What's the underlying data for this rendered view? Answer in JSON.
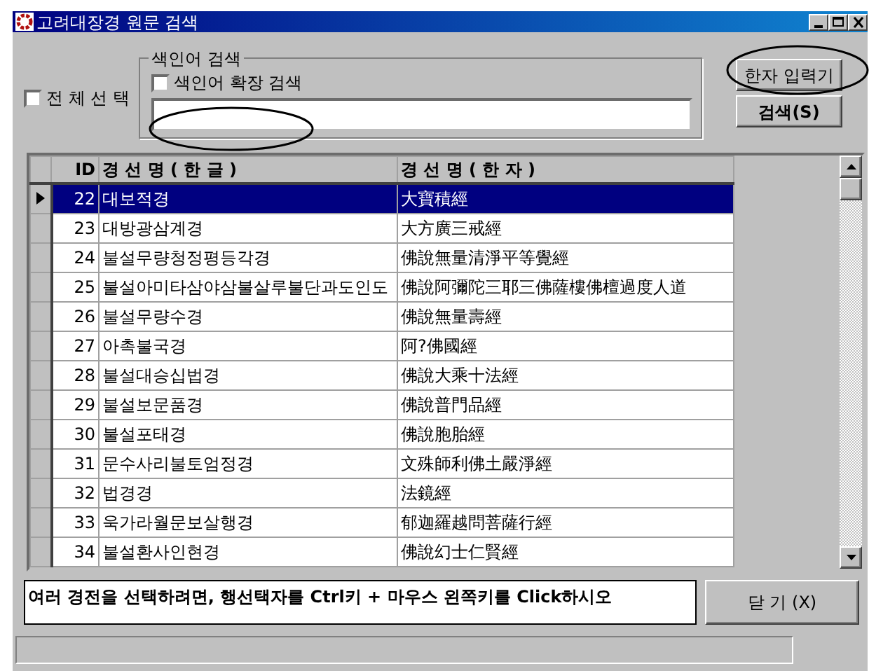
{
  "window": {
    "title": "고려대장경 원문 검색"
  },
  "select_all": {
    "label": "전 체 선 택",
    "checked": false
  },
  "index_search": {
    "legend": "색인어 검색",
    "extended": {
      "label": "색인어 확장 검색",
      "checked": false
    }
  },
  "buttons": [
    {
      "label": "한자 입력기",
      "bold": false
    },
    {
      "label": "검색(S)",
      "bold": true
    }
  ],
  "table": {
    "columns": [
      "ID",
      "경 선 명 ( 한 글 )",
      "경 선 명 ( 한 자 )"
    ],
    "rows": [
      {
        "id": "22",
        "name_ko": "대보적경",
        "name_hanja": "大寶積經",
        "selected": true
      },
      {
        "id": "23",
        "name_ko": "대방광삼계경",
        "name_hanja": "大方廣三戒經",
        "selected": false
      },
      {
        "id": "24",
        "name_ko": "불설무량청정평등각경",
        "name_hanja": "佛說無量清淨平等覺經",
        "selected": false
      },
      {
        "id": "25",
        "name_ko": "불설아미타삼야삼불살루불단과도인도",
        "name_hanja": "佛說阿彌陀三耶三佛薩樓佛檀過度人道",
        "selected": false
      },
      {
        "id": "26",
        "name_ko": "불설무량수경",
        "name_hanja": "佛說無量壽經",
        "selected": false
      },
      {
        "id": "27",
        "name_ko": "아촉불국경",
        "name_hanja": "阿?佛國經",
        "selected": false
      },
      {
        "id": "28",
        "name_ko": "불설대승십법경",
        "name_hanja": "佛說大乘十法經",
        "selected": false
      },
      {
        "id": "29",
        "name_ko": "불설보문품경",
        "name_hanja": "佛說普門品經",
        "selected": false
      },
      {
        "id": "30",
        "name_ko": "불설포태경",
        "name_hanja": "佛說胞胎經",
        "selected": false
      },
      {
        "id": "31",
        "name_ko": "문수사리불토엄정경",
        "name_hanja": "文殊師利佛土嚴淨經",
        "selected": false
      },
      {
        "id": "32",
        "name_ko": "법경경",
        "name_hanja": "法鏡經",
        "selected": false
      },
      {
        "id": "33",
        "name_ko": "욱가라월문보살행경",
        "name_hanja": "郁迦羅越問菩薩行經",
        "selected": false
      },
      {
        "id": "34",
        "name_ko": "불설환사인현경",
        "name_hanja": "佛說幻士仁賢經",
        "selected": false
      }
    ]
  },
  "hint": "여러 경전을 선택하려면, 행선택자를 Ctrl키 + 마우스 왼쪽키를 Click하시오",
  "close_button": {
    "label": "닫 기 (X)"
  },
  "annotations": [
    {
      "kind": "ellipse"
    },
    {
      "kind": "ellipse"
    }
  ]
}
